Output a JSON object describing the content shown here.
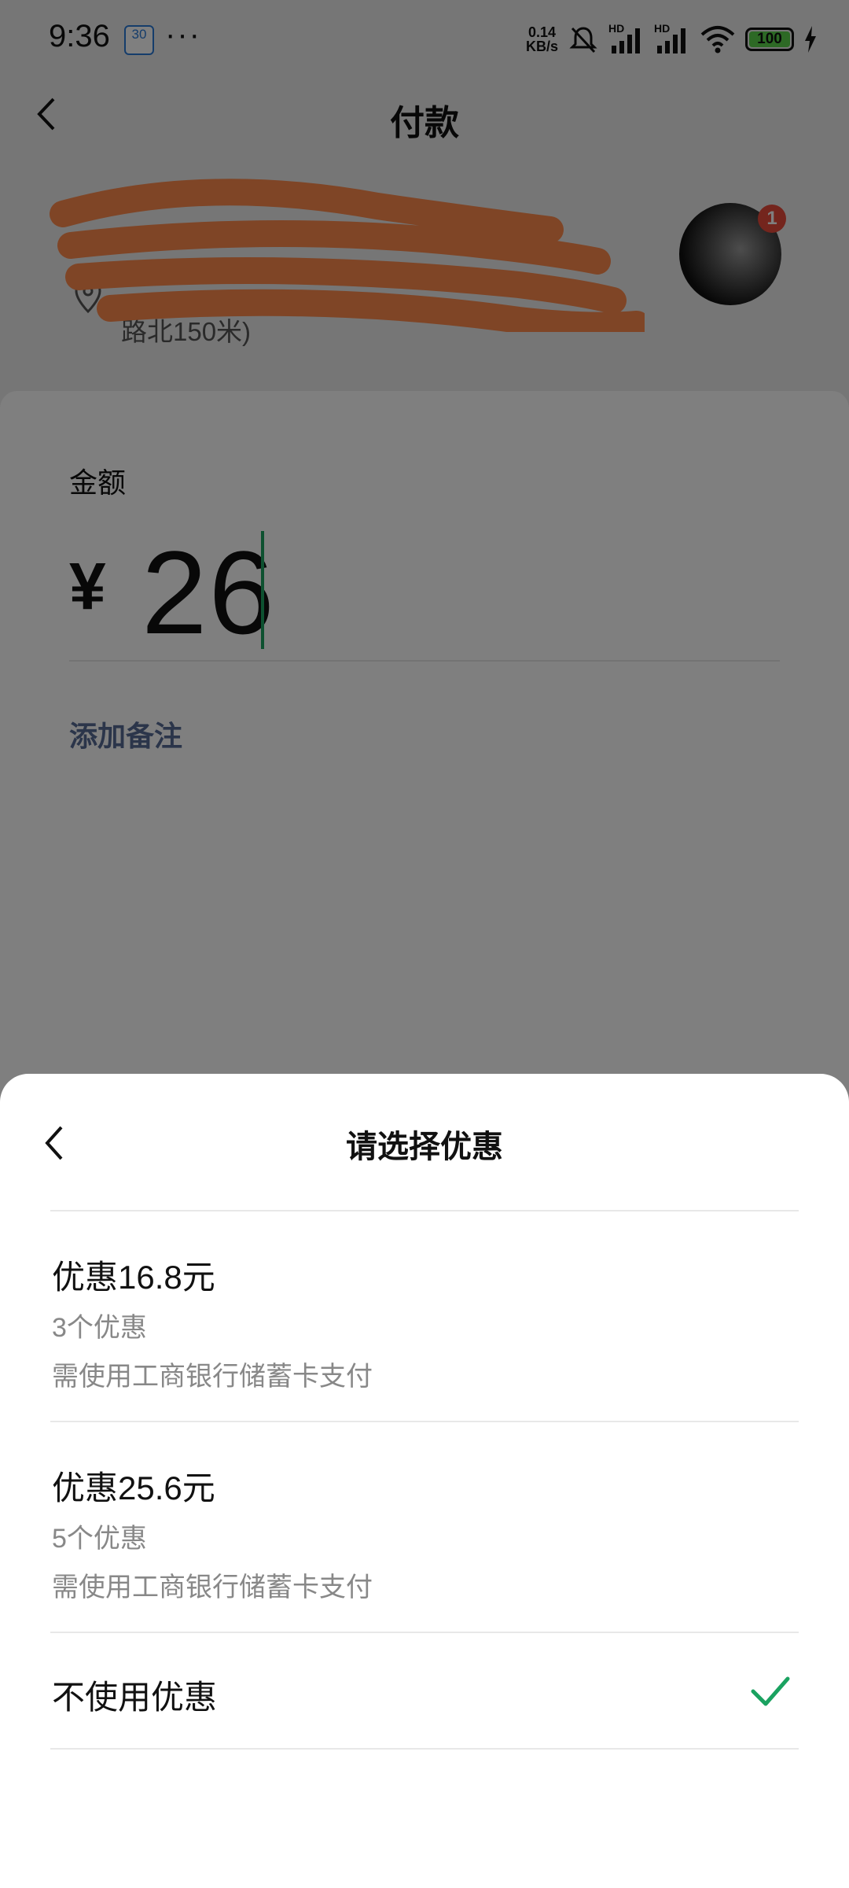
{
  "status_bar": {
    "time": "9:36",
    "calendar_day": "30",
    "more": "···",
    "network_speed_value": "0.14",
    "network_speed_unit": "KB/s",
    "hd1": "HD",
    "hd2": "HD",
    "battery": "100"
  },
  "nav": {
    "title": "付款"
  },
  "merchant": {
    "name": "",
    "address_line": "路北150米)",
    "avatar_badge": "1"
  },
  "payment": {
    "amount_label": "金额",
    "currency": "¥",
    "amount": "26",
    "add_note": "添加备注"
  },
  "sheet": {
    "title": "请选择优惠",
    "options": [
      {
        "title": "优惠16.8元",
        "count": "3个优惠",
        "requirement": "需使用工商银行储蓄卡支付",
        "selected": false
      },
      {
        "title": "优惠25.6元",
        "count": "5个优惠",
        "requirement": "需使用工商银行储蓄卡支付",
        "selected": false
      },
      {
        "title": "不使用优惠",
        "selected": true
      }
    ]
  },
  "colors": {
    "accent_green": "#1aa260",
    "link_blue": "#576b95",
    "redaction": "#ff8a4d"
  }
}
